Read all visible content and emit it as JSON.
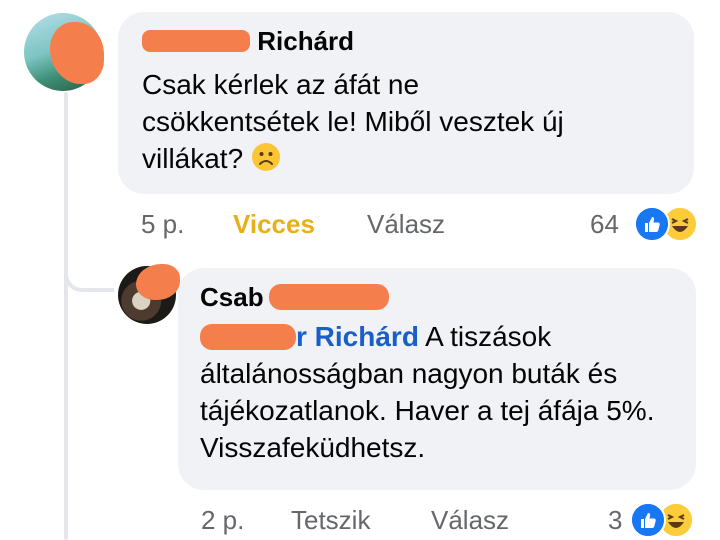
{
  "comments": [
    {
      "author": "Richárd",
      "text": "Csak kérlek az áfát ne csökkentsétek le! Miből vesztek új villákat?",
      "emoji": "sad-face-emoji",
      "time": "5 p.",
      "reaction_label": "Vicces",
      "reply_label": "Válasz",
      "reaction_count": "64",
      "reaction_icons": [
        "like-icon",
        "haha-icon"
      ]
    },
    {
      "author": "Csab",
      "mention": "r Richárd",
      "text": "A tiszások általánosságban nagyon buták és tájékozatlanok. Haver a tej áfája 5%. Visszafeküdhetsz.",
      "time": "2 p.",
      "like_label": "Tetszik",
      "reply_label": "Válasz",
      "reaction_count": "3",
      "reaction_icons": [
        "like-icon",
        "haha-icon"
      ]
    }
  ],
  "colors": {
    "bubble": "#f0f2f5",
    "mention": "#1a5fc9",
    "reaction_active": "#e8b018",
    "meta": "#65676b",
    "redaction": "#f47f4c"
  }
}
